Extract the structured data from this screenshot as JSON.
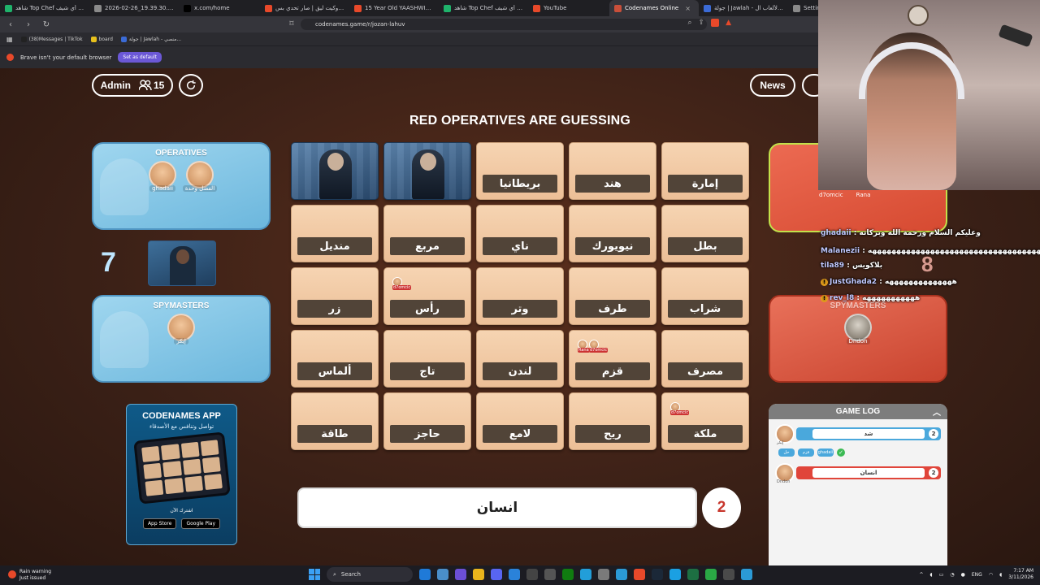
{
  "browser": {
    "tabs": [
      {
        "label": "شاهد Top Chef سُش أي شيف",
        "color": "#1fb36b",
        "active": false
      },
      {
        "label": "2026-02-26_19.39.30.png (1469...",
        "color": "#8a8a8a",
        "active": false
      },
      {
        "label": "x.com/home",
        "color": "#000000",
        "active": false
      },
      {
        "label": "بطولة روكيت ليق | صار تحدي بس...",
        "color": "#e8492a",
        "active": false
      },
      {
        "label": "15 Year Old YAASHWIN SARAW...",
        "color": "#e8492a",
        "active": false
      },
      {
        "label": "شاهد Top Chef سُش أي شيف",
        "color": "#1fb36b",
        "active": false
      },
      {
        "label": "YouTube",
        "color": "#e8492a",
        "active": false
      },
      {
        "label": "Codenames Online",
        "color": "#c94f3a",
        "active": true
      },
      {
        "label": "جولة | Jawlah - منصة الألعاب ال...",
        "color": "#3b6bd6",
        "active": false
      },
      {
        "label": "Settings -",
        "color": "#8a8a8a",
        "active": false
      }
    ],
    "close_glyph": "×",
    "url": "codenames.game/r/jozan-lahuv",
    "bookmarks": [
      {
        "label": "(38)Messages | TikTok",
        "color": "#222222"
      },
      {
        "label": "board",
        "color": "#e8c11c"
      },
      {
        "label": "جولة | Jawlah - منصي...",
        "color": "#3b6bd6"
      }
    ],
    "notice_text": "Brave isn't your default browser",
    "notice_button": "Set as default"
  },
  "game": {
    "admin_label": "Admin",
    "player_count": "15",
    "news_label": "News",
    "headline": "RED OPERATIVES ARE GUESSING",
    "blue_team": {
      "operatives_title": "OPERATIVES",
      "operatives": [
        "ghadaii",
        "الفضل وحدة"
      ],
      "spymasters_title": "SPYMASTERS",
      "spymasters": [
        "إيكر"
      ],
      "score": "7"
    },
    "red_team": {
      "operatives": [
        "d7omcic",
        "Rana"
      ],
      "spymasters_title": "SPYMASTERS",
      "spymasters": [
        "Dndon"
      ],
      "score": "8"
    },
    "promo": {
      "title": "CODENAMES APP",
      "subtitle": "تواصل وتنافس مع الأصدقاء",
      "download": "اشترك الآن",
      "stores": [
        "App Store",
        "Google Play"
      ]
    },
    "board": [
      {
        "word": "",
        "revealed": "blue",
        "marks": []
      },
      {
        "word": "",
        "revealed": "blue",
        "marks": []
      },
      {
        "word": "بريطانيا",
        "revealed": "",
        "marks": []
      },
      {
        "word": "هند",
        "revealed": "",
        "marks": []
      },
      {
        "word": "إمارة",
        "revealed": "",
        "marks": []
      },
      {
        "word": "منديل",
        "revealed": "",
        "marks": []
      },
      {
        "word": "مربع",
        "revealed": "",
        "marks": []
      },
      {
        "word": "ناي",
        "revealed": "",
        "marks": []
      },
      {
        "word": "نيويورك",
        "revealed": "",
        "marks": []
      },
      {
        "word": "بطل",
        "revealed": "",
        "marks": []
      },
      {
        "word": "زر",
        "revealed": "",
        "marks": []
      },
      {
        "word": "رأس",
        "revealed": "",
        "marks": [
          "d7omcic"
        ]
      },
      {
        "word": "وتر",
        "revealed": "",
        "marks": []
      },
      {
        "word": "طرف",
        "revealed": "",
        "marks": []
      },
      {
        "word": "شراب",
        "revealed": "",
        "marks": []
      },
      {
        "word": "ألماس",
        "revealed": "",
        "marks": []
      },
      {
        "word": "تاج",
        "revealed": "",
        "marks": []
      },
      {
        "word": "لندن",
        "revealed": "",
        "marks": []
      },
      {
        "word": "قزم",
        "revealed": "",
        "marks": [
          "Rana",
          "d7omcic"
        ]
      },
      {
        "word": "مصرف",
        "revealed": "",
        "marks": []
      },
      {
        "word": "طاقة",
        "revealed": "",
        "marks": []
      },
      {
        "word": "حاجز",
        "revealed": "",
        "marks": []
      },
      {
        "word": "لامع",
        "revealed": "",
        "marks": []
      },
      {
        "word": "ريح",
        "revealed": "",
        "marks": []
      },
      {
        "word": "ملكة",
        "revealed": "",
        "marks": [
          "d7omcic"
        ]
      }
    ],
    "clue": {
      "word": "انسان",
      "number": "2"
    },
    "game_log": {
      "title": "GAME LOG",
      "entries": [
        {
          "team": "blue",
          "player": "إيكر",
          "clue": "شد",
          "number": "2"
        },
        {
          "team": "red",
          "player": "Dndon",
          "clue": "انسان",
          "number": "2"
        }
      ],
      "guesses": [
        "حل",
        "قزم",
        "ghadaii"
      ]
    },
    "colors": {
      "blue": "#4aa8dc",
      "red": "#e0453a",
      "card": "#f0c8a2",
      "label": "#514438"
    }
  },
  "chat": [
    {
      "user": "ghadaii",
      "text": "وعليكم السلام ورحمة الله وبركاته",
      "badge": false
    },
    {
      "user": "Malanezii",
      "text": "ههههههههههههههههههههههههههههههههههههه",
      "badge": false
    },
    {
      "user": "tila89",
      "text": "بلاكويس",
      "badge": false
    },
    {
      "user": "JustGhada2",
      "text": "ههههههههههههههه",
      "badge": true
    },
    {
      "user": "rev_l8",
      "text": "هههههههههههه",
      "badge": true
    }
  ],
  "taskbar": {
    "weather_title": "Rain warning",
    "weather_sub": "Just issued",
    "search": "Search",
    "lang": "ENG",
    "time": "7:17 AM",
    "date": "3/11/2026"
  }
}
